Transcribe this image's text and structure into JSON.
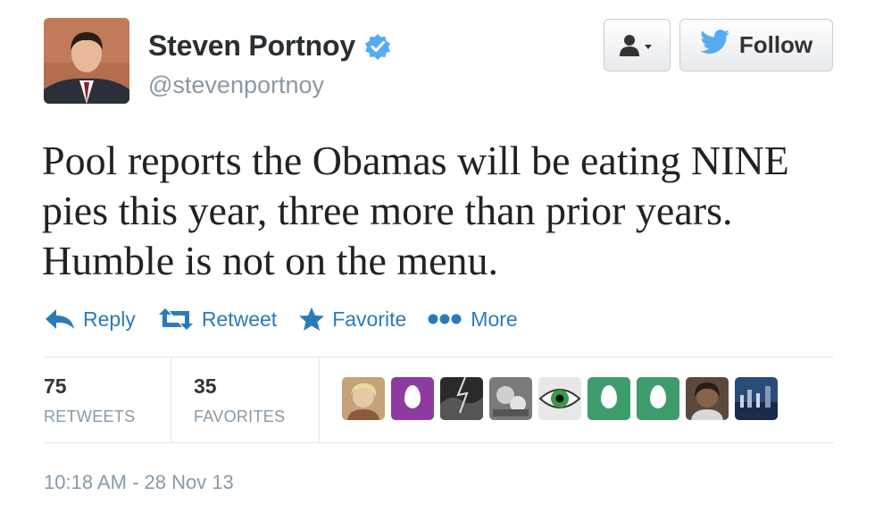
{
  "tweet": {
    "display_name": "Steven Portnoy",
    "handle": "@stevenportnoy",
    "text": "Pool reports the Obamas will be eating NINE pies this year, three more than prior years. Humble is not on the menu.",
    "timestamp": "10:18 AM - 28 Nov 13"
  },
  "header_buttons": {
    "user_actions_icon": "user-dropdown-icon",
    "follow_label": "Follow"
  },
  "actions": {
    "reply": "Reply",
    "retweet": "Retweet",
    "favorite": "Favorite",
    "more": "More"
  },
  "stats": {
    "retweets_count": "75",
    "retweets_label": "RETWEETS",
    "favorites_count": "35",
    "favorites_label": "FAVORITES"
  },
  "favoriters": [
    "avatar-photo",
    "egg-purple",
    "avatar-photo",
    "avatar-photo",
    "avatar-photo",
    "egg-green",
    "egg-green",
    "avatar-photo",
    "avatar-photo"
  ],
  "colors": {
    "link_blue": "#2b7bb9",
    "verified_blue": "#55acee",
    "twitter_blue": "#55acee",
    "muted_gray": "#8899a6"
  }
}
